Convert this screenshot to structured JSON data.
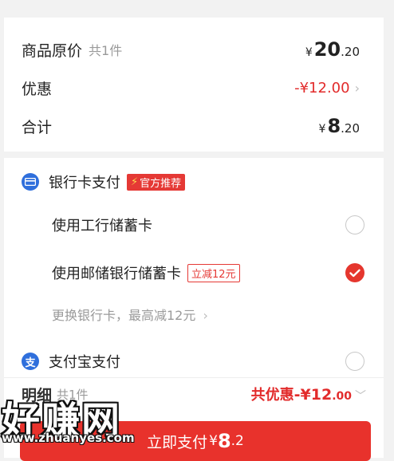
{
  "summary": {
    "original": {
      "label": "商品原价",
      "count": "共1件",
      "currency": "¥",
      "int": "20",
      "dec": ".20"
    },
    "discount": {
      "label": "优惠",
      "value": "-¥12.00"
    },
    "total": {
      "label": "合计",
      "currency": "¥",
      "int": "8",
      "dec": ".20"
    }
  },
  "payment": {
    "bank_card": {
      "label": "银行卡支付",
      "badge": "官方推荐",
      "icon": "bank-card-icon"
    },
    "options": [
      {
        "label": "使用工行储蓄卡",
        "selected": false
      },
      {
        "label": "使用邮储银行储蓄卡",
        "promo": "立减12元",
        "selected": true
      }
    ],
    "change_card": "更换银行卡，最高减12元",
    "alipay": {
      "label": "支付宝支付",
      "icon": "alipay-icon",
      "icon_char": "支",
      "selected": false
    }
  },
  "detail": {
    "label": "明细",
    "count": "共1件",
    "saving_label": "共优惠",
    "saving_int": "-¥12",
    "saving_dec": ".00"
  },
  "pay_button": {
    "label": "立即支付",
    "currency": "¥",
    "int": "8",
    "dec": ".2"
  },
  "watermark": {
    "text": "好赚网",
    "url": "www.zhuanyes.com"
  },
  "colors": {
    "accent": "#e5362e",
    "icon_blue": "#2f6fdc"
  }
}
